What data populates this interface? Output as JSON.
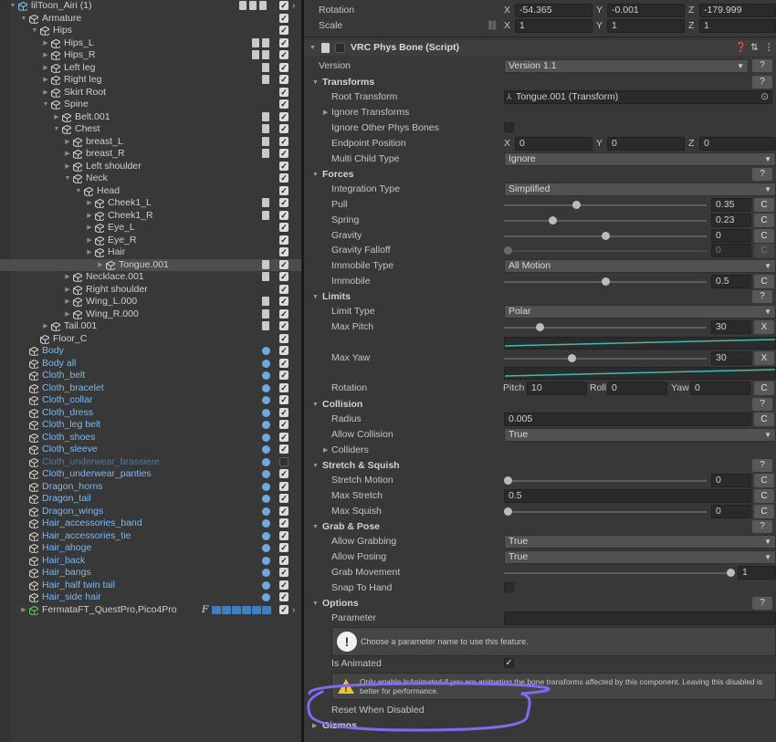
{
  "hierarchy": {
    "rows": [
      {
        "name": "lilToon_Airi (1)",
        "blue": false,
        "faded": false,
        "depth": 0,
        "fold": "down",
        "icon": "prefab",
        "check": true,
        "extra": "scene-icons"
      },
      {
        "name": "Armature",
        "blue": false,
        "faded": false,
        "depth": 1,
        "fold": "down",
        "icon": "cube",
        "check": true
      },
      {
        "name": "Hips",
        "blue": false,
        "faded": false,
        "depth": 2,
        "fold": "down",
        "icon": "cube",
        "check": true
      },
      {
        "name": "Hips_L",
        "blue": false,
        "faded": false,
        "depth": 3,
        "fold": "right",
        "icon": "cube",
        "check": true,
        "cpl": 2
      },
      {
        "name": "Hips_R",
        "blue": false,
        "faded": false,
        "depth": 3,
        "fold": "right",
        "icon": "cube",
        "check": true,
        "cpl": 2
      },
      {
        "name": "Left leg",
        "blue": false,
        "faded": false,
        "depth": 3,
        "fold": "right",
        "icon": "cube",
        "check": true,
        "cpl": 1
      },
      {
        "name": "Right leg",
        "blue": false,
        "faded": false,
        "depth": 3,
        "fold": "right",
        "icon": "cube",
        "check": true,
        "cpl": 1
      },
      {
        "name": "Skirt Root",
        "blue": false,
        "faded": false,
        "depth": 3,
        "fold": "right",
        "icon": "cube",
        "check": true
      },
      {
        "name": "Spine",
        "blue": false,
        "faded": false,
        "depth": 3,
        "fold": "down",
        "icon": "cube",
        "check": true
      },
      {
        "name": "Belt.001",
        "blue": false,
        "faded": false,
        "depth": 4,
        "fold": "right",
        "icon": "cube",
        "check": true,
        "cpl": 1
      },
      {
        "name": "Chest",
        "blue": false,
        "faded": false,
        "depth": 4,
        "fold": "down",
        "icon": "cube",
        "check": true,
        "cpl": 1
      },
      {
        "name": "breast_L",
        "blue": false,
        "faded": false,
        "depth": 5,
        "fold": "right",
        "icon": "cube",
        "check": true,
        "cpl": 1
      },
      {
        "name": "breast_R",
        "blue": false,
        "faded": false,
        "depth": 5,
        "fold": "right",
        "icon": "cube",
        "check": true,
        "cpl": 1
      },
      {
        "name": "Left shoulder",
        "blue": false,
        "faded": false,
        "depth": 5,
        "fold": "right",
        "icon": "cube",
        "check": true
      },
      {
        "name": "Neck",
        "blue": false,
        "faded": false,
        "depth": 5,
        "fold": "down",
        "icon": "cube",
        "check": true
      },
      {
        "name": "Head",
        "blue": false,
        "faded": false,
        "depth": 6,
        "fold": "down",
        "icon": "cube",
        "check": true
      },
      {
        "name": "Cheek1_L",
        "blue": false,
        "faded": false,
        "depth": 7,
        "fold": "right",
        "icon": "cube",
        "check": true,
        "cpl": 1
      },
      {
        "name": "Cheek1_R",
        "blue": false,
        "faded": false,
        "depth": 7,
        "fold": "right",
        "icon": "cube",
        "check": true,
        "cpl": 1
      },
      {
        "name": "Eye_L",
        "blue": false,
        "faded": false,
        "depth": 7,
        "fold": "right",
        "icon": "cube",
        "check": true
      },
      {
        "name": "Eye_R",
        "blue": false,
        "faded": false,
        "depth": 7,
        "fold": "right",
        "icon": "cube",
        "check": true
      },
      {
        "name": "Hair",
        "blue": false,
        "faded": false,
        "depth": 7,
        "fold": "right",
        "icon": "cube",
        "check": true
      },
      {
        "name": "Tongue.001",
        "blue": false,
        "faded": false,
        "depth": 8,
        "fold": "right",
        "icon": "cube",
        "check": true,
        "cpl": 1,
        "selected": true
      },
      {
        "name": "Necklace.001",
        "blue": false,
        "faded": false,
        "depth": 5,
        "fold": "right",
        "icon": "cube",
        "check": true,
        "cpl": 1
      },
      {
        "name": "Right shoulder",
        "blue": false,
        "faded": false,
        "depth": 5,
        "fold": "right",
        "icon": "cube",
        "check": true
      },
      {
        "name": "Wing_L.000",
        "blue": false,
        "faded": false,
        "depth": 5,
        "fold": "right",
        "icon": "cube",
        "check": true,
        "cpl": 1
      },
      {
        "name": "Wing_R.000",
        "blue": false,
        "faded": false,
        "depth": 5,
        "fold": "right",
        "icon": "cube",
        "check": true,
        "cpl": 1
      },
      {
        "name": "Tail.001",
        "blue": false,
        "faded": false,
        "depth": 3,
        "fold": "right",
        "icon": "cube",
        "check": true,
        "cpl": 1
      },
      {
        "name": "Floor_C",
        "blue": false,
        "faded": false,
        "depth": 2,
        "fold": "none",
        "icon": "cube",
        "check": true
      },
      {
        "name": "Body",
        "blue": true,
        "faded": false,
        "depth": 1,
        "fold": "none",
        "icon": "cube",
        "check": true,
        "cpl": 3
      },
      {
        "name": "Body all",
        "blue": true,
        "faded": false,
        "depth": 1,
        "fold": "none",
        "icon": "cube",
        "check": true,
        "cpl": 3
      },
      {
        "name": "Cloth_belt",
        "blue": true,
        "faded": false,
        "depth": 1,
        "fold": "none",
        "icon": "cube",
        "check": true,
        "cpl": 3
      },
      {
        "name": "Cloth_bracelet",
        "blue": true,
        "faded": false,
        "depth": 1,
        "fold": "none",
        "icon": "cube",
        "check": true,
        "cpl": 3
      },
      {
        "name": "Cloth_collar",
        "blue": true,
        "faded": false,
        "depth": 1,
        "fold": "none",
        "icon": "cube",
        "check": true,
        "cpl": 3
      },
      {
        "name": "Cloth_dress",
        "blue": true,
        "faded": false,
        "depth": 1,
        "fold": "none",
        "icon": "cube",
        "check": true,
        "cpl": 3
      },
      {
        "name": "Cloth_leg belt",
        "blue": true,
        "faded": false,
        "depth": 1,
        "fold": "none",
        "icon": "cube",
        "check": true,
        "cpl": 3
      },
      {
        "name": "Cloth_shoes",
        "blue": true,
        "faded": false,
        "depth": 1,
        "fold": "none",
        "icon": "cube",
        "check": true,
        "cpl": 3
      },
      {
        "name": "Cloth_sleeve",
        "blue": true,
        "faded": false,
        "depth": 1,
        "fold": "none",
        "icon": "cube",
        "check": true,
        "cpl": 3
      },
      {
        "name": "Cloth_underwear_brassiere",
        "blue": true,
        "faded": true,
        "depth": 1,
        "fold": "none",
        "icon": "cube",
        "check": false,
        "cpl": 3
      },
      {
        "name": "Cloth_underwear_panties",
        "blue": true,
        "faded": false,
        "depth": 1,
        "fold": "none",
        "icon": "cube",
        "check": true,
        "cpl": 3
      },
      {
        "name": "Dragon_horns",
        "blue": true,
        "faded": false,
        "depth": 1,
        "fold": "none",
        "icon": "cube",
        "check": true,
        "cpl": 3
      },
      {
        "name": "Dragon_tail",
        "blue": true,
        "faded": false,
        "depth": 1,
        "fold": "none",
        "icon": "cube",
        "check": true,
        "cpl": 3
      },
      {
        "name": "Dragon_wings",
        "blue": true,
        "faded": false,
        "depth": 1,
        "fold": "none",
        "icon": "cube",
        "check": true,
        "cpl": 3
      },
      {
        "name": "Hair_accessories_band",
        "blue": true,
        "faded": false,
        "depth": 1,
        "fold": "none",
        "icon": "cube",
        "check": true,
        "cpl": 3
      },
      {
        "name": "Hair_accessories_tie",
        "blue": true,
        "faded": false,
        "depth": 1,
        "fold": "none",
        "icon": "cube",
        "check": true,
        "cpl": 3
      },
      {
        "name": "Hair_ahoge",
        "blue": true,
        "faded": false,
        "depth": 1,
        "fold": "none",
        "icon": "cube",
        "check": true,
        "cpl": 3
      },
      {
        "name": "Hair_back",
        "blue": true,
        "faded": false,
        "depth": 1,
        "fold": "none",
        "icon": "cube",
        "check": true,
        "cpl": 3
      },
      {
        "name": "Hair_bangs",
        "blue": true,
        "faded": false,
        "depth": 1,
        "fold": "none",
        "icon": "cube",
        "check": true,
        "cpl": 3
      },
      {
        "name": "Hair_half twin tail",
        "blue": true,
        "faded": false,
        "depth": 1,
        "fold": "none",
        "icon": "cube",
        "check": true,
        "cpl": 3
      },
      {
        "name": "Hair_side hair",
        "blue": true,
        "faded": false,
        "depth": 1,
        "fold": "none",
        "icon": "cube",
        "check": true,
        "cpl": 3
      },
      {
        "name": "FermataFT_QuestPro,Pico4Pro",
        "blue": false,
        "faded": false,
        "depth": 1,
        "fold": "right",
        "icon": "prefab-green",
        "check": true,
        "extra": "fermata"
      }
    ],
    "fermata_f": "F"
  },
  "inspector": {
    "transform": {
      "rotation_label": "Rotation",
      "scale_label": "Scale",
      "rotation": {
        "x": "-54.365",
        "y": "-0.001",
        "z": "-179.999"
      },
      "scale": {
        "x": "1",
        "y": "1",
        "z": "1"
      },
      "axis_x": "X",
      "axis_y": "Y",
      "axis_z": "Z"
    },
    "component_title": "VRC Phys Bone (Script)",
    "version_label": "Version",
    "version_value": "Version 1.1",
    "sections": {
      "transforms": "Transforms",
      "forces": "Forces",
      "limits": "Limits",
      "collision": "Collision",
      "stretch": "Stretch & Squish",
      "grab": "Grab & Pose",
      "options": "Options",
      "gizmos": "Gizmos"
    },
    "root_transform_label": "Root Transform",
    "root_transform_value": "Tongue.001 (Transform)",
    "ignore_transforms_label": "Ignore Transforms",
    "ignore_other_label": "Ignore Other Phys Bones",
    "endpoint_label": "Endpoint Position",
    "endpoint": {
      "x": "0",
      "y": "0",
      "z": "0"
    },
    "multichild_label": "Multi Child Type",
    "multichild_value": "Ignore",
    "integration_label": "Integration Type",
    "integration_value": "Simplified",
    "pull_label": "Pull",
    "pull": "0.35",
    "spring_label": "Spring",
    "spring": "0.23",
    "gravity_label": "Gravity",
    "gravity": "0",
    "gravity_falloff_label": "Gravity Falloff",
    "gravity_falloff": "0",
    "immobile_type_label": "Immobile Type",
    "immobile_type_value": "All Motion",
    "immobile_label": "Immobile",
    "immobile": "0.5",
    "limit_type_label": "Limit Type",
    "limit_type_value": "Polar",
    "max_pitch_label": "Max Pitch",
    "max_pitch": "30",
    "max_yaw_label": "Max Yaw",
    "max_yaw": "30",
    "rotation_label": "Rotation",
    "pitch_label": "Pitch",
    "pitch": "10",
    "roll_label": "Roll",
    "roll": "0",
    "yaw_label": "Yaw",
    "yaw": "0",
    "radius_label": "Radius",
    "radius": "0.005",
    "allow_collision_label": "Allow Collision",
    "allow_collision_value": "True",
    "colliders_label": "Colliders",
    "stretch_motion_label": "Stretch Motion",
    "stretch_motion": "0",
    "max_stretch_label": "Max Stretch",
    "max_stretch": "0.5",
    "max_squish_label": "Max Squish",
    "max_squish": "0",
    "allow_grabbing_label": "Allow Grabbing",
    "allow_grabbing_value": "True",
    "allow_posing_label": "Allow Posing",
    "allow_posing_value": "True",
    "grab_movement_label": "Grab Movement",
    "grab_movement": "1",
    "snap_label": "Snap To Hand",
    "parameter_label": "Parameter",
    "parameter_info": "Choose a parameter name to use this feature.",
    "is_animated_label": "Is Animated",
    "warning_text": "Only enable IsAnimated if you are animating the bone transforms affected by this component. Leaving this disabled is better for performance.",
    "reset_label": "Reset When Disabled",
    "c_label": "C",
    "x_label": "X",
    "q_label": "?"
  },
  "colors": {
    "annotation": "#7b6cf0",
    "curve": "#3fbcb0",
    "selection": "#4d4d4d",
    "blue_text": "#7cb8f5"
  }
}
